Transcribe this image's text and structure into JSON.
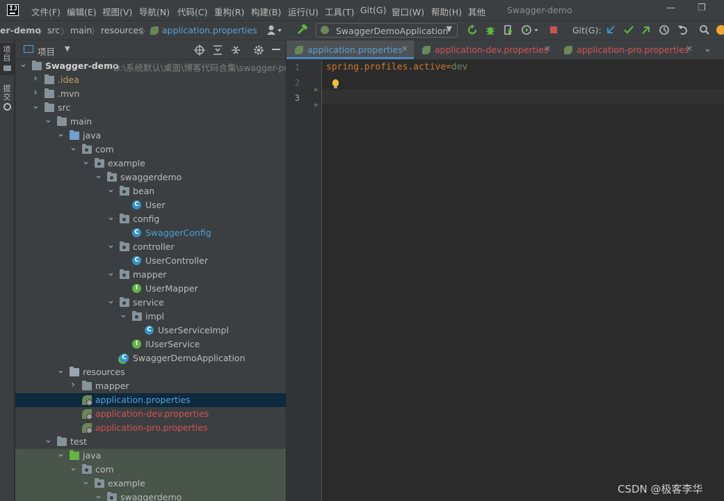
{
  "menubar": {
    "items": [
      "文件(F)",
      "编辑(E)",
      "视图(V)",
      "导航(N)",
      "代码(C)",
      "重构(R)",
      "构建(B)",
      "运行(U)",
      "工具(T)",
      "Git(G)",
      "窗口(W)",
      "帮助(H)",
      "其他"
    ],
    "window_title": "Swagger-demo",
    "minimize": "—",
    "restore": "❐"
  },
  "breadcrumb": {
    "items": [
      "er-demo",
      "src",
      "main",
      "resources",
      "application.properties"
    ],
    "sep": "〉"
  },
  "toolbar": {
    "run_config": "SwaggerDemoApplication",
    "git_label": "Git(G):"
  },
  "left_strip": {
    "project": "项目",
    "commit": "提交"
  },
  "project_panel": {
    "title": "项目",
    "root_path": "D:\\系统默认\\桌面\\博客代码合集\\swagger-pro"
  },
  "tree": [
    {
      "label": "Swagger-demo",
      "depth": 0,
      "arrow": "down",
      "icon": "folder",
      "bold": true
    },
    {
      "label": ".idea",
      "depth": 1,
      "arrow": "right",
      "icon": "folder",
      "color": "#c0a060"
    },
    {
      "label": ".mvn",
      "depth": 1,
      "arrow": "right",
      "icon": "folder"
    },
    {
      "label": "src",
      "depth": 1,
      "arrow": "down",
      "icon": "folder"
    },
    {
      "label": "main",
      "depth": 2,
      "arrow": "down",
      "icon": "folder"
    },
    {
      "label": "java",
      "depth": 3,
      "arrow": "down",
      "icon": "folder-src"
    },
    {
      "label": "com",
      "depth": 4,
      "arrow": "down",
      "icon": "folder-pkg"
    },
    {
      "label": "example",
      "depth": 5,
      "arrow": "down",
      "icon": "folder-pkg"
    },
    {
      "label": "swaggerdemo",
      "depth": 6,
      "arrow": "down",
      "icon": "folder-pkg"
    },
    {
      "label": "bean",
      "depth": 7,
      "arrow": "down",
      "icon": "folder-pkg"
    },
    {
      "label": "User",
      "depth": 8,
      "arrow": "none",
      "icon": "class"
    },
    {
      "label": "config",
      "depth": 7,
      "arrow": "down",
      "icon": "folder-pkg"
    },
    {
      "label": "SwaggerConfig",
      "depth": 8,
      "arrow": "none",
      "icon": "class",
      "color": "#4a9fd5"
    },
    {
      "label": "controller",
      "depth": 7,
      "arrow": "down",
      "icon": "folder-pkg"
    },
    {
      "label": "UserController",
      "depth": 8,
      "arrow": "none",
      "icon": "class"
    },
    {
      "label": "mapper",
      "depth": 7,
      "arrow": "down",
      "icon": "folder-pkg"
    },
    {
      "label": "UserMapper",
      "depth": 8,
      "arrow": "none",
      "icon": "interface"
    },
    {
      "label": "service",
      "depth": 7,
      "arrow": "down",
      "icon": "folder-pkg"
    },
    {
      "label": "impl",
      "depth": 8,
      "arrow": "down",
      "icon": "folder-pkg"
    },
    {
      "label": "UserServiceImpl",
      "depth": 9,
      "arrow": "none",
      "icon": "class"
    },
    {
      "label": "IUserService",
      "depth": 8,
      "arrow": "none",
      "icon": "interface"
    },
    {
      "label": "SwaggerDemoApplication",
      "depth": 7,
      "arrow": "none",
      "icon": "spring-class"
    },
    {
      "label": "resources",
      "depth": 3,
      "arrow": "down",
      "icon": "folder-res"
    },
    {
      "label": "mapper",
      "depth": 4,
      "arrow": "right",
      "icon": "folder"
    },
    {
      "label": "application.properties",
      "depth": 4,
      "arrow": "none",
      "icon": "leaf",
      "color": "#5a9fd6",
      "selected": true
    },
    {
      "label": "application-dev.properties",
      "depth": 4,
      "arrow": "none",
      "icon": "leaf",
      "color": "#d25252"
    },
    {
      "label": "application-pro.properties",
      "depth": 4,
      "arrow": "none",
      "icon": "leaf",
      "color": "#d25252"
    },
    {
      "label": "test",
      "depth": 2,
      "arrow": "down",
      "icon": "folder"
    },
    {
      "label": "java",
      "depth": 3,
      "arrow": "down",
      "icon": "folder-test"
    },
    {
      "label": "com",
      "depth": 4,
      "arrow": "down",
      "icon": "folder-pkg"
    },
    {
      "label": "example",
      "depth": 5,
      "arrow": "down",
      "icon": "folder-pkg"
    },
    {
      "label": "swaggerdemo",
      "depth": 6,
      "arrow": "down",
      "icon": "folder-pkg"
    }
  ],
  "editor": {
    "tabs": [
      {
        "label": "application.properties",
        "color": "#5a9fd6",
        "active": true
      },
      {
        "label": "application-dev.properties",
        "color": "#d25252",
        "active": false
      },
      {
        "label": "application-pro.properties",
        "color": "#d25252",
        "active": false
      }
    ],
    "close_glyph": "✕",
    "line_numbers": [
      "1",
      "2",
      "3"
    ],
    "code": {
      "key": "spring.profiles.active",
      "eq": "=",
      "value": "dev"
    }
  },
  "colors": {
    "key": "#cc7832",
    "value": "#6a8759",
    "selected_row": "#0d293e",
    "accent": "#4a88c7"
  },
  "watermark": "CSDN @极客李华"
}
